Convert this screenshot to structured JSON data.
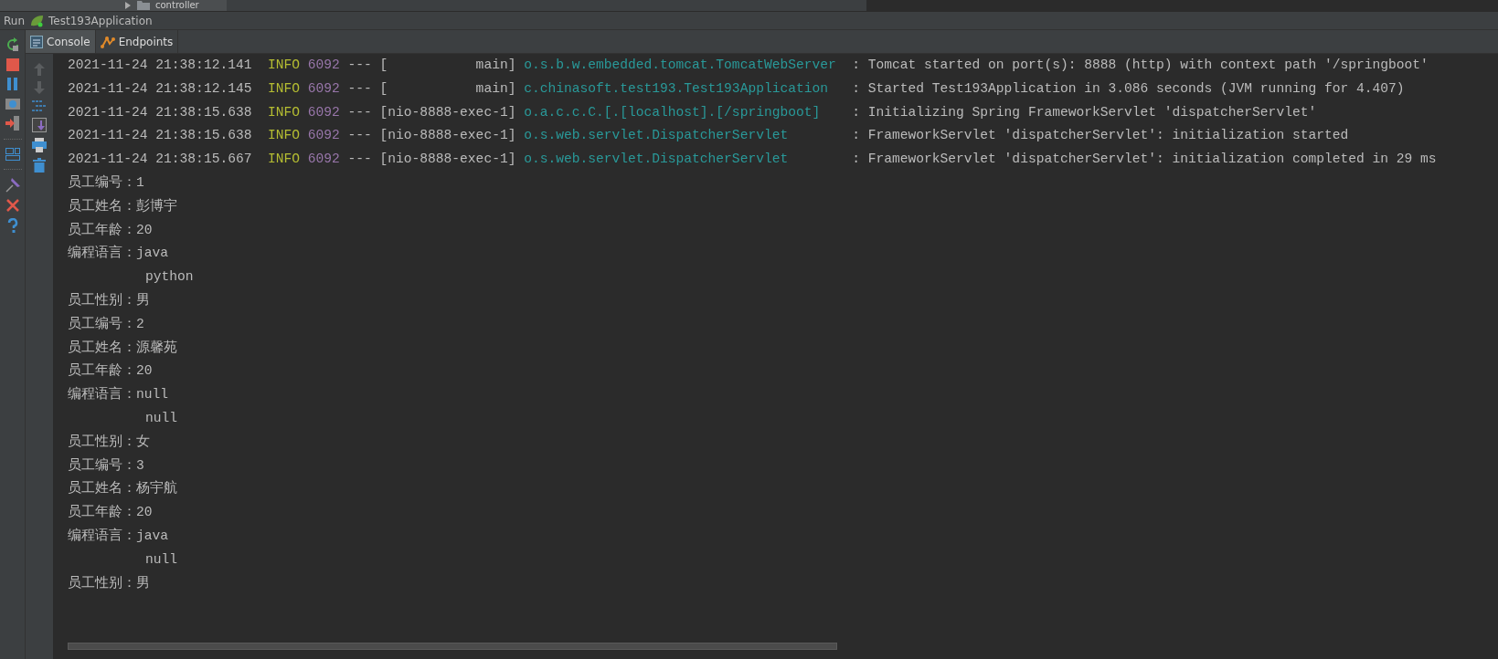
{
  "project_tree": {
    "folder": "controller"
  },
  "run_bar": {
    "label": "Run",
    "config": "Test193Application"
  },
  "tabs": [
    {
      "label": "Console",
      "selected": true
    },
    {
      "label": "Endpoints",
      "selected": false
    }
  ],
  "console": {
    "log_lines": [
      {
        "timestamp": "2021-11-24 21:38:12.141",
        "level": "INFO",
        "pid": "6092",
        "separator": "---",
        "thread": "[           main]",
        "logger": "o.s.b.w.embedded.tomcat.TomcatWebServer",
        "message": ": Tomcat started on port(s): 8888 (http) with context path '/springboot'"
      },
      {
        "timestamp": "2021-11-24 21:38:12.145",
        "level": "INFO",
        "pid": "6092",
        "separator": "---",
        "thread": "[           main]",
        "logger": "c.chinasoft.test193.Test193Application",
        "message": ": Started Test193Application in 3.086 seconds (JVM running for 4.407)"
      },
      {
        "timestamp": "2021-11-24 21:38:15.638",
        "level": "INFO",
        "pid": "6092",
        "separator": "---",
        "thread": "[nio-8888-exec-1]",
        "logger": "o.a.c.c.C.[.[localhost].[/springboot]",
        "message": ": Initializing Spring FrameworkServlet 'dispatcherServlet'"
      },
      {
        "timestamp": "2021-11-24 21:38:15.638",
        "level": "INFO",
        "pid": "6092",
        "separator": "---",
        "thread": "[nio-8888-exec-1]",
        "logger": "o.s.web.servlet.DispatcherServlet",
        "message": ": FrameworkServlet 'dispatcherServlet': initialization started"
      },
      {
        "timestamp": "2021-11-24 21:38:15.667",
        "level": "INFO",
        "pid": "6092",
        "separator": "---",
        "thread": "[nio-8888-exec-1]",
        "logger": "o.s.web.servlet.DispatcherServlet",
        "message": ": FrameworkServlet 'dispatcherServlet': initialization completed in 29 ms"
      }
    ],
    "output_lines": [
      {
        "kind": "field",
        "text": "员工编号：1"
      },
      {
        "kind": "field",
        "text": "员工姓名：彭博宇"
      },
      {
        "kind": "field",
        "text": "员工年龄：20"
      },
      {
        "kind": "field",
        "text": "编程语言：java"
      },
      {
        "kind": "continuation",
        "text": "python"
      },
      {
        "kind": "field",
        "text": "员工性别：男"
      },
      {
        "kind": "field",
        "text": "员工编号：2"
      },
      {
        "kind": "field",
        "text": "员工姓名：源馨苑"
      },
      {
        "kind": "field",
        "text": "员工年龄：20"
      },
      {
        "kind": "field",
        "text": "编程语言：null"
      },
      {
        "kind": "continuation",
        "text": "null"
      },
      {
        "kind": "field",
        "text": "员工性别：女"
      },
      {
        "kind": "field",
        "text": "员工编号：3"
      },
      {
        "kind": "field",
        "text": "员工姓名：杨宇航"
      },
      {
        "kind": "field",
        "text": "员工年龄：20"
      },
      {
        "kind": "field",
        "text": "编程语言：java"
      },
      {
        "kind": "continuation",
        "text": "null"
      },
      {
        "kind": "field",
        "text": "员工性别：男"
      }
    ]
  }
}
